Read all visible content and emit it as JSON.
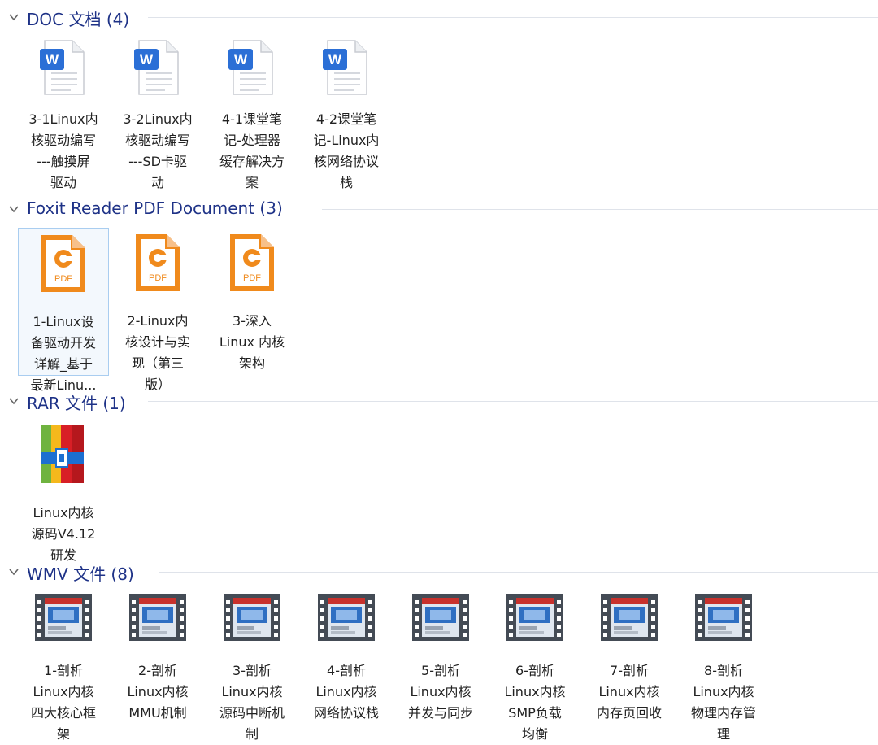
{
  "colors": {
    "group_title": "#1e3287",
    "selection_border": "#a9cdf0",
    "selection_bg": "#f3f8fd",
    "pdf_orange": "#f08a1c",
    "doc_blue": "#2b6fd6"
  },
  "groups": [
    {
      "title": "DOC 文档 (4)",
      "icon": "word-document-icon",
      "items": [
        {
          "lines": [
            "3-1Linux内",
            "核驱动编写",
            "---触摸屏",
            "驱动"
          ]
        },
        {
          "lines": [
            "3-2Linux内",
            "核驱动编写",
            "---SD卡驱",
            "动"
          ]
        },
        {
          "lines": [
            "4-1课堂笔",
            "记-处理器",
            "缓存解决方",
            "案"
          ]
        },
        {
          "lines": [
            "4-2课堂笔",
            "记-Linux内",
            "核网络协议",
            "栈"
          ]
        }
      ]
    },
    {
      "title": "Foxit Reader PDF Document (3)",
      "icon": "foxit-pdf-icon",
      "icon_label": "PDF",
      "items": [
        {
          "lines": [
            "1-Linux设",
            "备驱动开发",
            "详解_基于",
            "最新Linu..."
          ],
          "selected": true
        },
        {
          "lines": [
            "2-Linux内",
            "核设计与实",
            "现（第三",
            "版）"
          ]
        },
        {
          "lines": [
            "3-深入",
            "Linux 内核",
            "架构"
          ]
        }
      ]
    },
    {
      "title": "RAR 文件 (1)",
      "icon": "rar-archive-icon",
      "items": [
        {
          "lines": [
            "Linux内核",
            "源码V4.12",
            "研发"
          ]
        }
      ]
    },
    {
      "title": "WMV 文件 (8)",
      "icon": "video-file-icon",
      "items": [
        {
          "lines": [
            "1-剖析",
            "Linux内核",
            "四大核心框",
            "架"
          ]
        },
        {
          "lines": [
            "2-剖析",
            "Linux内核",
            "MMU机制"
          ]
        },
        {
          "lines": [
            "3-剖析",
            "Linux内核",
            "源码中断机",
            "制"
          ]
        },
        {
          "lines": [
            "4-剖析",
            "Linux内核",
            "网络协议栈"
          ]
        },
        {
          "lines": [
            "5-剖析",
            "Linux内核",
            "并发与同步"
          ]
        },
        {
          "lines": [
            "6-剖析",
            "Linux内核",
            "SMP负载",
            "均衡"
          ]
        },
        {
          "lines": [
            "7-剖析",
            "Linux内核",
            "内存页回收"
          ]
        },
        {
          "lines": [
            "8-剖析",
            "Linux内核",
            "物理内存管",
            "理"
          ]
        }
      ]
    }
  ]
}
